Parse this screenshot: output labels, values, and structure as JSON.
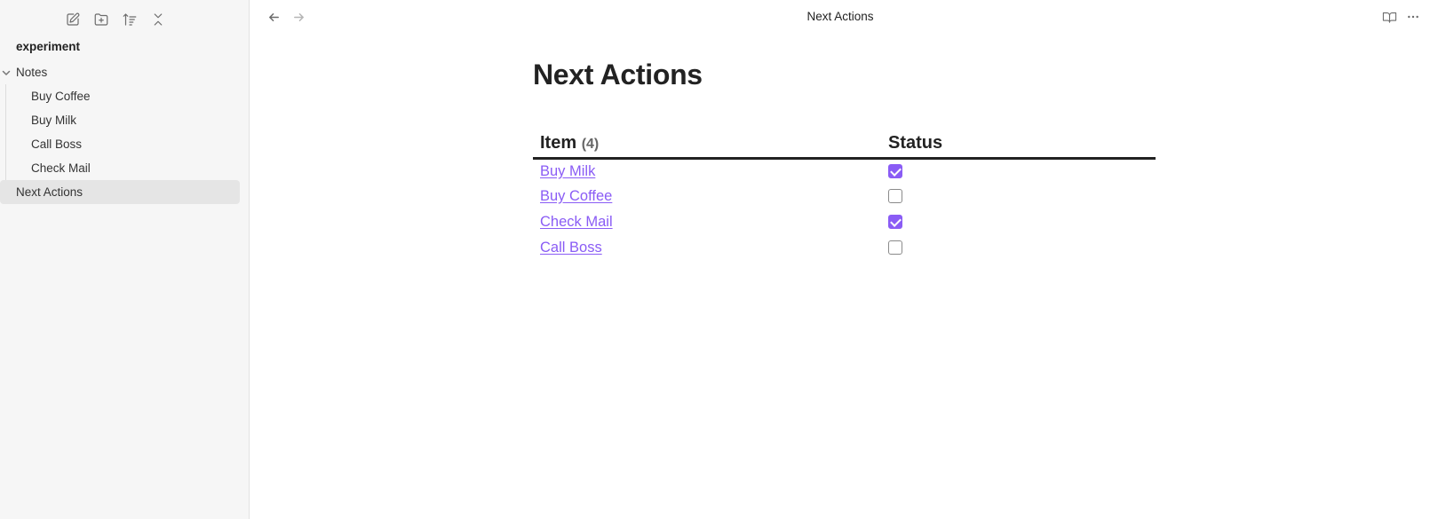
{
  "sidebar": {
    "toolbar": {
      "icons": [
        "new-note-icon",
        "new-folder-icon",
        "sort-icon",
        "collapse-all-icon"
      ]
    },
    "vault_name": "experiment",
    "tree": {
      "folder_label": "Notes",
      "files": [
        {
          "label": "Buy Coffee"
        },
        {
          "label": "Buy Milk"
        },
        {
          "label": "Call Boss"
        },
        {
          "label": "Check Mail"
        }
      ],
      "root_file": {
        "label": "Next Actions",
        "active": true
      }
    }
  },
  "main": {
    "tab_title": "Next Actions",
    "note_title": "Next Actions",
    "table": {
      "headers": {
        "item": "Item",
        "count": "(4)",
        "status": "Status"
      },
      "rows": [
        {
          "item": "Buy Milk",
          "checked": true
        },
        {
          "item": "Buy Coffee",
          "checked": false
        },
        {
          "item": "Check Mail",
          "checked": true
        },
        {
          "item": "Call Boss",
          "checked": false
        }
      ]
    },
    "accent_color": "#8a5cf5"
  }
}
